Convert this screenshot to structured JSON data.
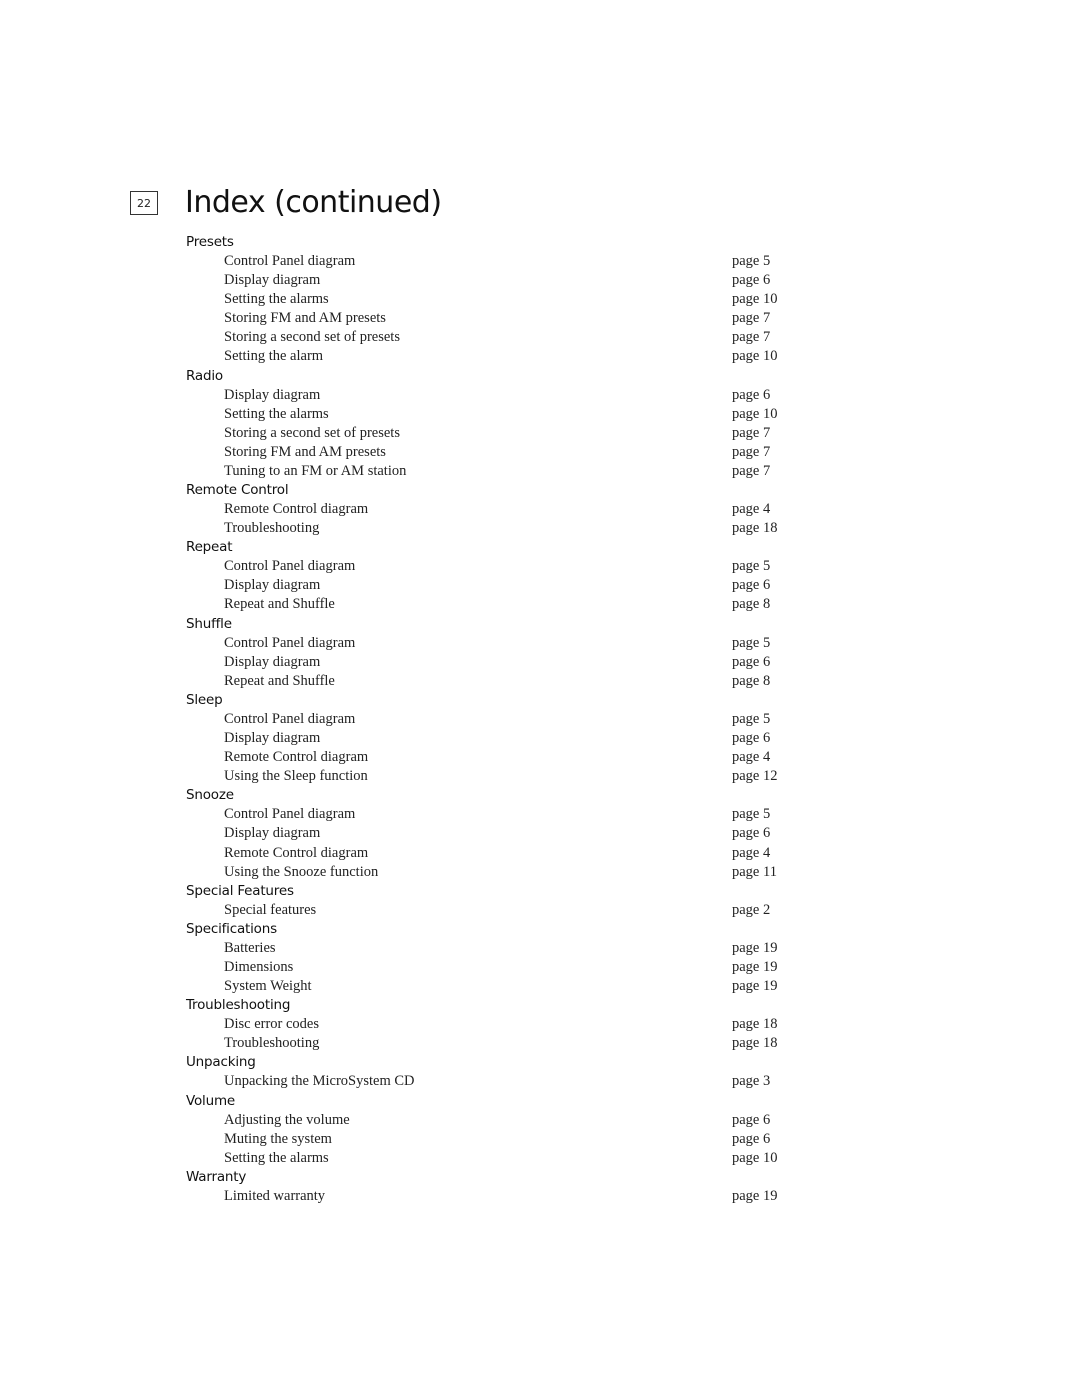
{
  "page_number": "22",
  "title": "Index (continued)",
  "sections": [
    {
      "heading": "Presets",
      "entries": [
        {
          "label": "Control Panel diagram",
          "page": "page 5"
        },
        {
          "label": "Display diagram",
          "page": "page 6"
        },
        {
          "label": "Setting the alarms",
          "page": "page 10"
        },
        {
          "label": "Storing FM and AM presets",
          "page": "page 7"
        },
        {
          "label": "Storing a second set of presets",
          "page": "page 7"
        },
        {
          "label": "Setting the alarm",
          "page": "page 10"
        }
      ]
    },
    {
      "heading": "Radio",
      "entries": [
        {
          "label": "Display diagram",
          "page": "page 6"
        },
        {
          "label": "Setting the alarms",
          "page": "page 10"
        },
        {
          "label": "Storing a second set of presets",
          "page": "page 7"
        },
        {
          "label": "Storing FM and AM presets",
          "page": "page 7"
        },
        {
          "label": "Tuning to an FM or AM station",
          "page": "page 7"
        }
      ]
    },
    {
      "heading": "Remote Control",
      "entries": [
        {
          "label": "Remote Control diagram",
          "page": "page 4"
        },
        {
          "label": "Troubleshooting",
          "page": "page 18"
        }
      ]
    },
    {
      "heading": "Repeat",
      "entries": [
        {
          "label": "Control Panel diagram",
          "page": "page 5"
        },
        {
          "label": "Display diagram",
          "page": "page 6"
        },
        {
          "label": "Repeat and Shuffle",
          "page": "page 8"
        }
      ]
    },
    {
      "heading": "Shuffle",
      "entries": [
        {
          "label": "Control Panel diagram",
          "page": "page 5"
        },
        {
          "label": "Display diagram",
          "page": "page 6"
        },
        {
          "label": "Repeat and Shuffle",
          "page": "page 8"
        }
      ]
    },
    {
      "heading": "Sleep",
      "entries": [
        {
          "label": "Control Panel diagram",
          "page": "page 5"
        },
        {
          "label": "Display diagram",
          "page": "page 6"
        },
        {
          "label": "Remote Control diagram",
          "page": "page 4"
        },
        {
          "label": "Using the Sleep function",
          "page": "page 12"
        }
      ]
    },
    {
      "heading": "Snooze",
      "entries": [
        {
          "label": "Control Panel diagram",
          "page": "page 5"
        },
        {
          "label": "Display diagram",
          "page": "page 6"
        },
        {
          "label": "Remote Control diagram",
          "page": "page 4"
        },
        {
          "label": "Using the Snooze function",
          "page": "page 11"
        }
      ]
    },
    {
      "heading": "Special Features",
      "entries": [
        {
          "label": "Special features",
          "page": "page 2"
        }
      ]
    },
    {
      "heading": "Specifications",
      "entries": [
        {
          "label": "Batteries",
          "page": "page 19"
        },
        {
          "label": "Dimensions",
          "page": "page 19"
        },
        {
          "label": "System Weight",
          "page": "page 19"
        }
      ]
    },
    {
      "heading": "Troubleshooting",
      "entries": [
        {
          "label": "Disc error codes",
          "page": "page 18"
        },
        {
          "label": "Troubleshooting",
          "page": "page 18"
        }
      ]
    },
    {
      "heading": "Unpacking",
      "entries": [
        {
          "label": "Unpacking the MicroSystem CD",
          "page": "page 3"
        }
      ]
    },
    {
      "heading": "Volume",
      "entries": [
        {
          "label": "Adjusting the volume",
          "page": "page 6"
        },
        {
          "label": "Muting the system",
          "page": "page 6"
        },
        {
          "label": "Setting the alarms",
          "page": "page 10"
        }
      ]
    },
    {
      "heading": "Warranty",
      "entries": [
        {
          "label": "Limited warranty",
          "page": "page 19"
        }
      ]
    }
  ]
}
